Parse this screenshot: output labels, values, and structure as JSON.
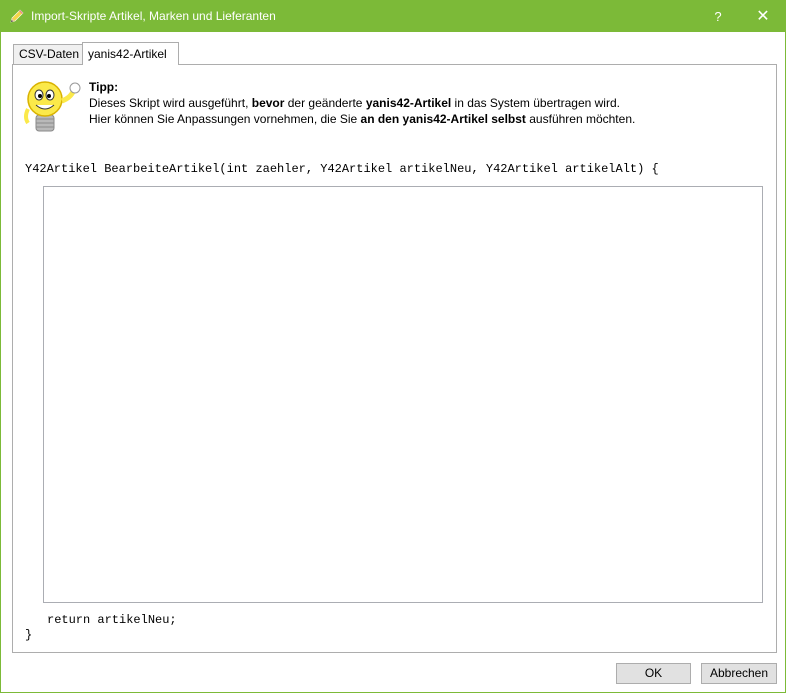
{
  "window": {
    "title": "Import-Skripte Artikel, Marken und Lieferanten",
    "help_label": "?",
    "close_label": "✕",
    "accent_color": "#7cba38"
  },
  "tabs": [
    {
      "label": "CSV-Daten",
      "active": false
    },
    {
      "label": "yanis42-Artikel",
      "active": true
    }
  ],
  "tip": {
    "title": "Tipp:",
    "line1": {
      "pre": "Dieses Skript wird ausgeführt, ",
      "bold1": "bevor",
      "mid": " der geänderte ",
      "bold2": "yanis42-Artikel",
      "post": " in das System übertragen wird."
    },
    "line2": {
      "pre": "Hier können Sie Anpassungen vornehmen, die Sie ",
      "bold1": "an den yanis42-Artikel selbst",
      "post": " ausführen möchten."
    }
  },
  "code": {
    "signature": "Y42Artikel BearbeiteArtikel(int zaehler, Y42Artikel artikelNeu, Y42Artikel artikelAlt) {",
    "editor_value": "",
    "return_line": "return artikelNeu;",
    "closing_brace": "}"
  },
  "buttons": {
    "ok": "OK",
    "cancel": "Abbrechen"
  }
}
